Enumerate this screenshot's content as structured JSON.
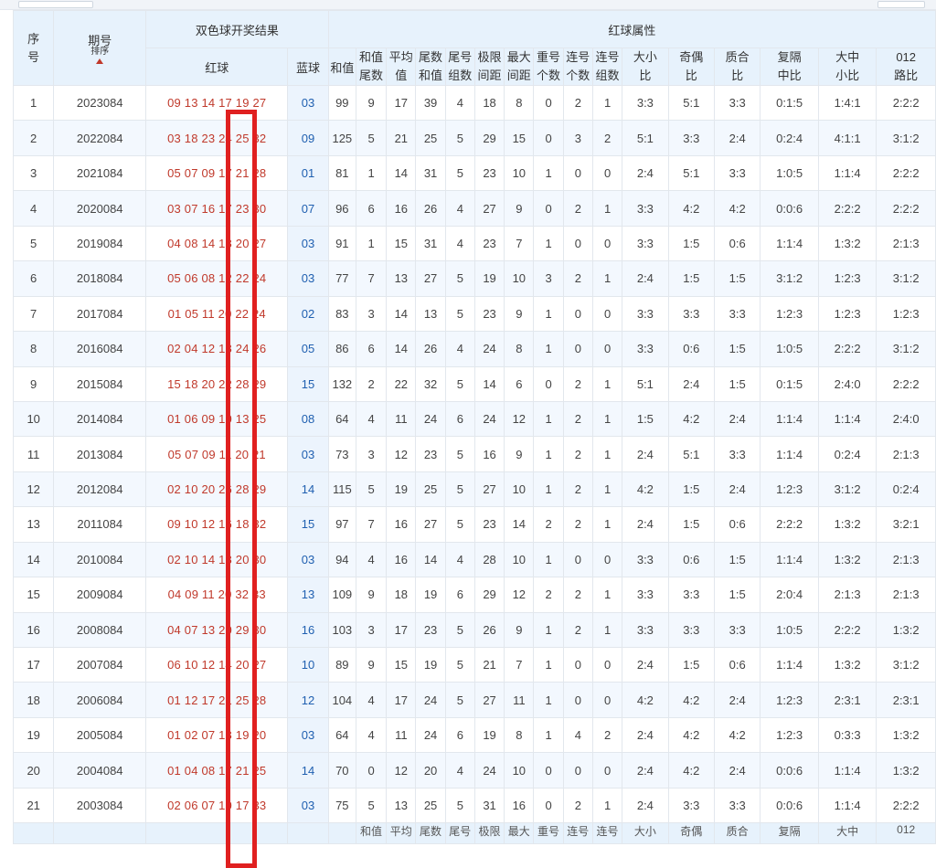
{
  "header": {
    "seq_line1": "序",
    "seq_line2": "号",
    "period": "期号",
    "sort_label": "排序",
    "result_group": "双色球开奖结果",
    "red_attr_group": "红球属性",
    "red": "红球",
    "blue": "蓝球",
    "sum": "和值",
    "attrs": [
      [
        "和值",
        "尾数"
      ],
      [
        "平均",
        "值"
      ],
      [
        "尾数",
        "和值"
      ],
      [
        "尾号",
        "组数"
      ],
      [
        "极限",
        "间距"
      ],
      [
        "最大",
        "间距"
      ],
      [
        "重号",
        "个数"
      ],
      [
        "连号",
        "个数"
      ],
      [
        "连号",
        "组数"
      ],
      [
        "大小",
        "比"
      ],
      [
        "奇偶",
        "比"
      ],
      [
        "质合",
        "比"
      ],
      [
        "复隔",
        "中比"
      ],
      [
        "大中",
        "小比"
      ],
      [
        "012",
        "路比"
      ]
    ]
  },
  "rows": [
    [
      "1",
      "2023084",
      "09 13 14 17 19 27",
      "03",
      "99",
      "9",
      "17",
      "39",
      "4",
      "18",
      "8",
      "0",
      "2",
      "1",
      "3:3",
      "5:1",
      "3:3",
      "0:1:5",
      "1:4:1",
      "2:2:2"
    ],
    [
      "2",
      "2022084",
      "03 18 23 24 25 32",
      "09",
      "125",
      "5",
      "21",
      "25",
      "5",
      "29",
      "15",
      "0",
      "3",
      "2",
      "5:1",
      "3:3",
      "2:4",
      "0:2:4",
      "4:1:1",
      "3:1:2"
    ],
    [
      "3",
      "2021084",
      "05 07 09 17 21 28",
      "01",
      "81",
      "1",
      "14",
      "31",
      "5",
      "23",
      "10",
      "1",
      "0",
      "0",
      "2:4",
      "5:1",
      "3:3",
      "1:0:5",
      "1:1:4",
      "2:2:2"
    ],
    [
      "4",
      "2020084",
      "03 07 16 17 23 30",
      "07",
      "96",
      "6",
      "16",
      "26",
      "4",
      "27",
      "9",
      "0",
      "2",
      "1",
      "3:3",
      "4:2",
      "4:2",
      "0:0:6",
      "2:2:2",
      "2:2:2"
    ],
    [
      "5",
      "2019084",
      "04 08 14 18 20 27",
      "03",
      "91",
      "1",
      "15",
      "31",
      "4",
      "23",
      "7",
      "1",
      "0",
      "0",
      "3:3",
      "1:5",
      "0:6",
      "1:1:4",
      "1:3:2",
      "2:1:3"
    ],
    [
      "6",
      "2018084",
      "05 06 08 12 22 24",
      "03",
      "77",
      "7",
      "13",
      "27",
      "5",
      "19",
      "10",
      "3",
      "2",
      "1",
      "2:4",
      "1:5",
      "1:5",
      "3:1:2",
      "1:2:3",
      "3:1:2"
    ],
    [
      "7",
      "2017084",
      "01 05 11 20 22 24",
      "02",
      "83",
      "3",
      "14",
      "13",
      "5",
      "23",
      "9",
      "1",
      "0",
      "0",
      "3:3",
      "3:3",
      "3:3",
      "1:2:3",
      "1:2:3",
      "1:2:3"
    ],
    [
      "8",
      "2016084",
      "02 04 12 18 24 26",
      "05",
      "86",
      "6",
      "14",
      "26",
      "4",
      "24",
      "8",
      "1",
      "0",
      "0",
      "3:3",
      "0:6",
      "1:5",
      "1:0:5",
      "2:2:2",
      "3:1:2"
    ],
    [
      "9",
      "2015084",
      "15 18 20 22 28 29",
      "15",
      "132",
      "2",
      "22",
      "32",
      "5",
      "14",
      "6",
      "0",
      "2",
      "1",
      "5:1",
      "2:4",
      "1:5",
      "0:1:5",
      "2:4:0",
      "2:2:2"
    ],
    [
      "10",
      "2014084",
      "01 06 09 10 13 25",
      "08",
      "64",
      "4",
      "11",
      "24",
      "6",
      "24",
      "12",
      "1",
      "2",
      "1",
      "1:5",
      "4:2",
      "2:4",
      "1:1:4",
      "1:1:4",
      "2:4:0"
    ],
    [
      "11",
      "2013084",
      "05 07 09 11 20 21",
      "03",
      "73",
      "3",
      "12",
      "23",
      "5",
      "16",
      "9",
      "1",
      "2",
      "1",
      "2:4",
      "5:1",
      "3:3",
      "1:1:4",
      "0:2:4",
      "2:1:3"
    ],
    [
      "12",
      "2012084",
      "02 10 20 26 28 29",
      "14",
      "115",
      "5",
      "19",
      "25",
      "5",
      "27",
      "10",
      "1",
      "2",
      "1",
      "4:2",
      "1:5",
      "2:4",
      "1:2:3",
      "3:1:2",
      "0:2:4"
    ],
    [
      "13",
      "2011084",
      "09 10 12 16 18 32",
      "15",
      "97",
      "7",
      "16",
      "27",
      "5",
      "23",
      "14",
      "2",
      "2",
      "1",
      "2:4",
      "1:5",
      "0:6",
      "2:2:2",
      "1:3:2",
      "3:2:1"
    ],
    [
      "14",
      "2010084",
      "02 10 14 18 20 30",
      "03",
      "94",
      "4",
      "16",
      "14",
      "4",
      "28",
      "10",
      "1",
      "0",
      "0",
      "3:3",
      "0:6",
      "1:5",
      "1:1:4",
      "1:3:2",
      "2:1:3"
    ],
    [
      "15",
      "2009084",
      "04 09 11 20 32 33",
      "13",
      "109",
      "9",
      "18",
      "19",
      "6",
      "29",
      "12",
      "2",
      "2",
      "1",
      "3:3",
      "3:3",
      "1:5",
      "2:0:4",
      "2:1:3",
      "2:1:3"
    ],
    [
      "16",
      "2008084",
      "04 07 13 20 29 30",
      "16",
      "103",
      "3",
      "17",
      "23",
      "5",
      "26",
      "9",
      "1",
      "2",
      "1",
      "3:3",
      "3:3",
      "3:3",
      "1:0:5",
      "2:2:2",
      "1:3:2"
    ],
    [
      "17",
      "2007084",
      "06 10 12 14 20 27",
      "10",
      "89",
      "9",
      "15",
      "19",
      "5",
      "21",
      "7",
      "1",
      "0",
      "0",
      "2:4",
      "1:5",
      "0:6",
      "1:1:4",
      "1:3:2",
      "3:1:2"
    ],
    [
      "18",
      "2006084",
      "01 12 17 21 25 28",
      "12",
      "104",
      "4",
      "17",
      "24",
      "5",
      "27",
      "11",
      "1",
      "0",
      "0",
      "4:2",
      "4:2",
      "2:4",
      "1:2:3",
      "2:3:1",
      "2:3:1"
    ],
    [
      "19",
      "2005084",
      "01 02 07 18 19 20",
      "03",
      "64",
      "4",
      "11",
      "24",
      "6",
      "19",
      "8",
      "1",
      "4",
      "2",
      "2:4",
      "4:2",
      "4:2",
      "1:2:3",
      "0:3:3",
      "1:3:2"
    ],
    [
      "20",
      "2004084",
      "01 04 08 17 21 25",
      "14",
      "70",
      "0",
      "12",
      "20",
      "4",
      "24",
      "10",
      "0",
      "0",
      "0",
      "2:4",
      "4:2",
      "2:4",
      "0:0:6",
      "1:1:4",
      "1:3:2"
    ],
    [
      "21",
      "2003084",
      "02 06 07 10 17 33",
      "03",
      "75",
      "5",
      "13",
      "25",
      "5",
      "31",
      "16",
      "0",
      "2",
      "1",
      "2:4",
      "3:3",
      "3:3",
      "0:0:6",
      "1:1:4",
      "2:2:2"
    ]
  ],
  "footer": [
    "",
    "",
    "",
    "",
    "",
    "和值",
    "平均",
    "尾数",
    "尾号",
    "极限",
    "最大",
    "重号",
    "连号",
    "连号",
    "大小",
    "奇偶",
    "质合",
    "复隔",
    "大中",
    "012"
  ],
  "colors": {
    "red_ball": "#c0392b",
    "blue_ball": "#1f5fb0",
    "header_bg": "#e7f2fc",
    "stripe_bg": "#f3f8fe",
    "highlight_box": "#e02020"
  },
  "icons": {
    "sort": "sort-up-arrow-icon"
  }
}
